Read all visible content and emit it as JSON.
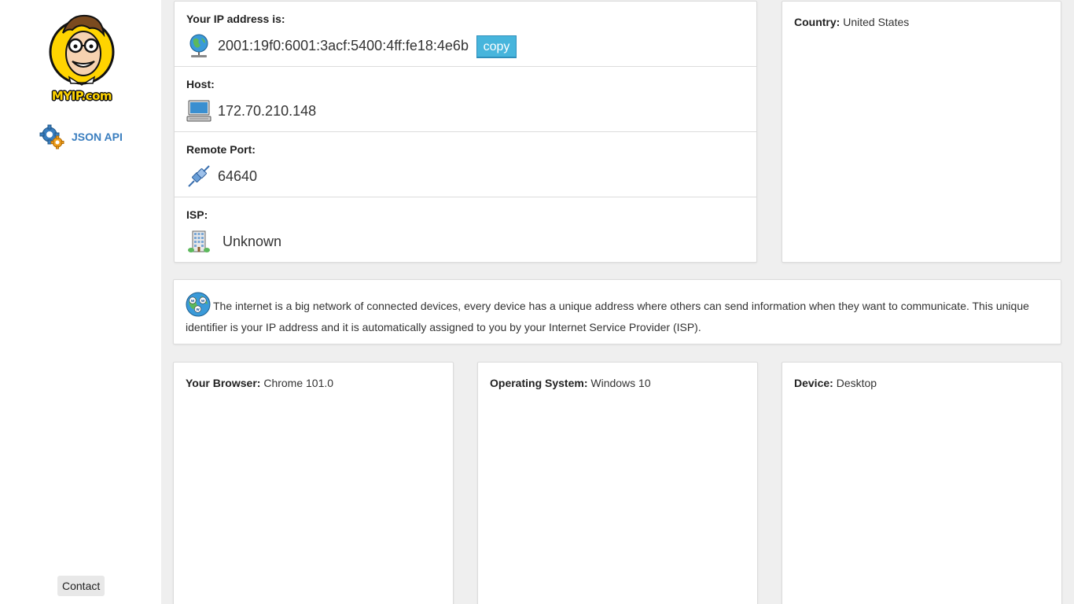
{
  "sidebar": {
    "logo_text": "MYIP.com",
    "json_api_label": "JSON API",
    "json_api_icon": "gears-icon",
    "contact_label": "Contact"
  },
  "ip_info": {
    "ip": {
      "label": "Your IP address is:",
      "value": "2001:19f0:6001:3acf:5400:4ff:fe18:4e6b",
      "icon": "network-globe-icon",
      "copy_label": "copy"
    },
    "host": {
      "label": "Host:",
      "value": "172.70.210.148",
      "icon": "computer-icon"
    },
    "port": {
      "label": "Remote Port:",
      "value": "64640",
      "icon": "plug-icon"
    },
    "isp": {
      "label": "ISP:",
      "value": "Unknown",
      "icon": "building-icon"
    }
  },
  "country": {
    "label": "Country:",
    "value": "United States"
  },
  "info": {
    "icon": "www-globe-icon",
    "text": "The internet is a big network of connected devices, every device has a unique address where others can send information when they want to communicate. This unique identifier is your IP address and it is automatically assigned to you by your Internet Service Provider (ISP)."
  },
  "browser": {
    "label": "Your Browser:",
    "value": "Chrome 101.0"
  },
  "os": {
    "label": "Operating System:",
    "value": "Windows 10"
  },
  "device": {
    "label": "Device:",
    "value": "Desktop"
  },
  "colors": {
    "accent": "#47b5dc",
    "link": "#3a7ebf",
    "logo_yellow": "#ffd400"
  }
}
